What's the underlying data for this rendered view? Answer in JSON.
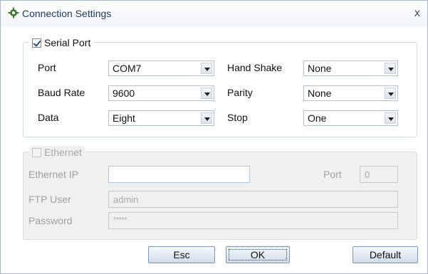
{
  "window": {
    "title": "Connection Settings",
    "close_label": "x"
  },
  "serial": {
    "legend": "Serial Port",
    "checked": true,
    "port": {
      "label": "Port",
      "value": "COM7"
    },
    "baud_rate": {
      "label": "Baud Rate",
      "value": "9600"
    },
    "data": {
      "label": "Data",
      "value": "Eight"
    },
    "hand_shake": {
      "label": "Hand Shake",
      "value": "None"
    },
    "parity": {
      "label": "Parity",
      "value": "None"
    },
    "stop": {
      "label": "Stop",
      "value": "One"
    }
  },
  "ethernet": {
    "legend": "Ethernet",
    "checked": false,
    "enabled": false,
    "ip": {
      "label": "Ethernet IP",
      "value": ""
    },
    "port": {
      "label": "Port",
      "value": "0"
    },
    "ftp_user": {
      "label": "FTP User",
      "value": "admin"
    },
    "password": {
      "label": "Password",
      "value": "*****"
    }
  },
  "buttons": {
    "esc": "Esc",
    "ok": "OK",
    "default": "Default"
  },
  "colors": {
    "title_text": "#1f3a66",
    "disabled_text": "#a0a0a0",
    "button_border": "#7d95b4"
  }
}
